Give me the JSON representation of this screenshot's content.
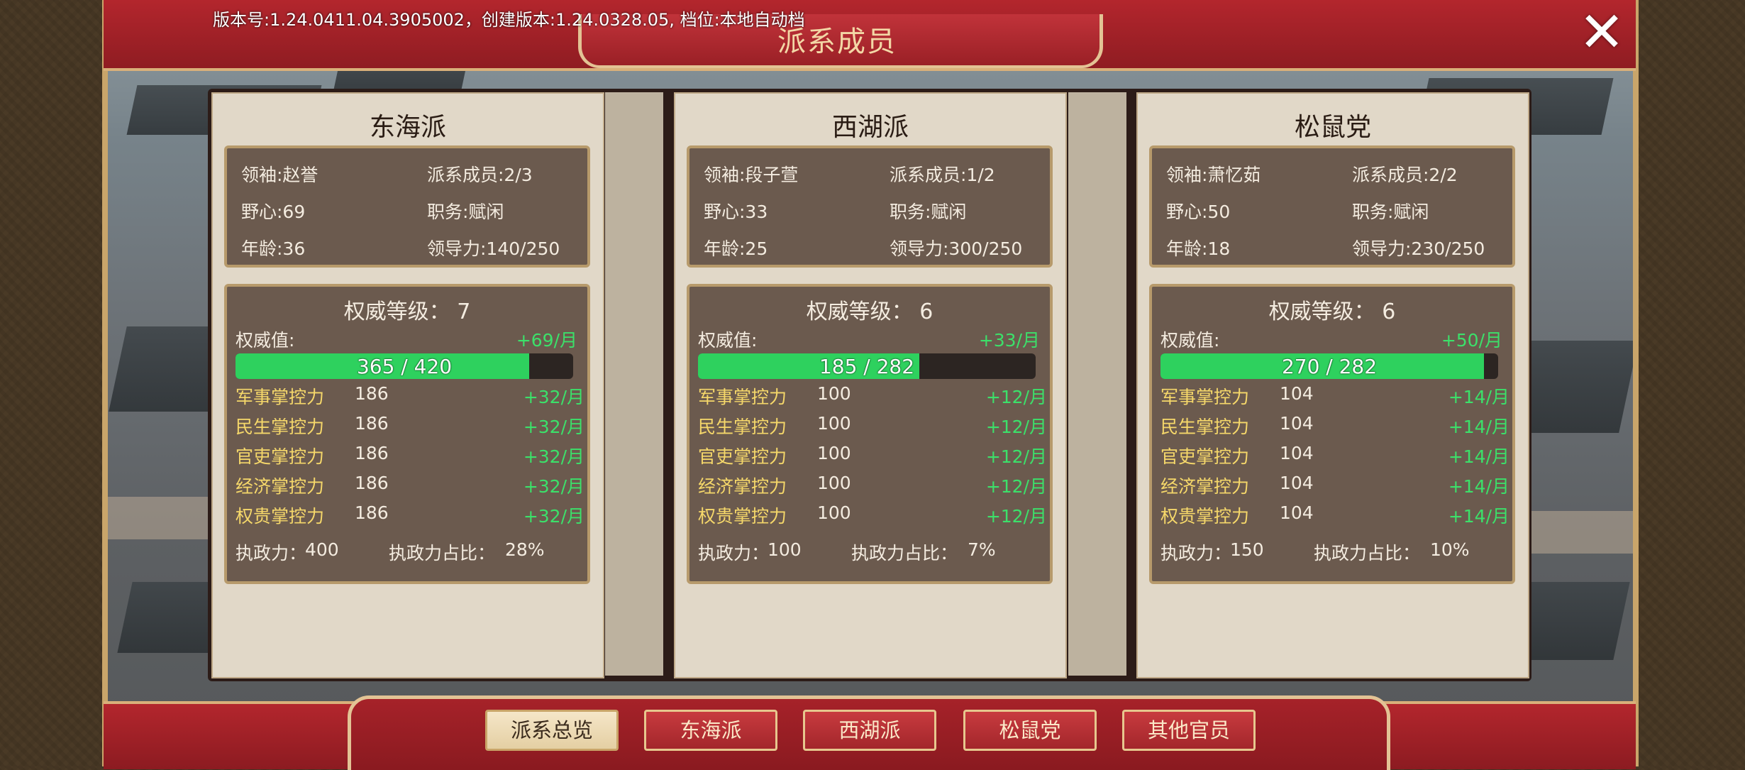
{
  "header": {
    "version_text": "版本号:1.24.0411.04.3905002，创建版本:1.24.0328.05, 档位:本地自动档",
    "title": "派系成员",
    "close_icon": "close-x-icon"
  },
  "colors": {
    "positive": "#3ce06a",
    "control_label": "#f6d86a",
    "bar_fill": "#2ed15e",
    "banner_red": "#b3262d"
  },
  "factions": [
    {
      "name": "东海派",
      "info": {
        "leader": "领袖:赵誉",
        "members": "派系成员:2/3",
        "ambition": "野心:69",
        "position": "职务:赋闲",
        "age": "年龄:36",
        "leadership": "领导力:140/250"
      },
      "authority": {
        "level_text": "权威等级： 7",
        "value_label": "权威值:",
        "rate": "+69/月",
        "current": 365,
        "max": 420,
        "bar_text": "365 / 420"
      },
      "controls": [
        {
          "name": "军事掌控力",
          "value": "186",
          "rate": "+32/月"
        },
        {
          "name": "民生掌控力",
          "value": "186",
          "rate": "+32/月"
        },
        {
          "name": "官吏掌控力",
          "value": "186",
          "rate": "+32/月"
        },
        {
          "name": "经济掌控力",
          "value": "186",
          "rate": "+32/月"
        },
        {
          "name": "权贵掌控力",
          "value": "186",
          "rate": "+32/月"
        }
      ],
      "governance": {
        "label": "执政力：",
        "value": "400",
        "ratio_label": "执政力占比：",
        "ratio": "28%"
      }
    },
    {
      "name": "西湖派",
      "info": {
        "leader": "领袖:段子萱",
        "members": "派系成员:1/2",
        "ambition": "野心:33",
        "position": "职务:赋闲",
        "age": "年龄:25",
        "leadership": "领导力:300/250"
      },
      "authority": {
        "level_text": "权威等级： 6",
        "value_label": "权威值:",
        "rate": "+33/月",
        "current": 185,
        "max": 282,
        "bar_text": "185 / 282"
      },
      "controls": [
        {
          "name": "军事掌控力",
          "value": "100",
          "rate": "+12/月"
        },
        {
          "name": "民生掌控力",
          "value": "100",
          "rate": "+12/月"
        },
        {
          "name": "官吏掌控力",
          "value": "100",
          "rate": "+12/月"
        },
        {
          "name": "经济掌控力",
          "value": "100",
          "rate": "+12/月"
        },
        {
          "name": "权贵掌控力",
          "value": "100",
          "rate": "+12/月"
        }
      ],
      "governance": {
        "label": "执政力：",
        "value": "100",
        "ratio_label": "执政力占比：",
        "ratio": "7%"
      }
    },
    {
      "name": "松鼠党",
      "info": {
        "leader": "领袖:萧忆茹",
        "members": "派系成员:2/2",
        "ambition": "野心:50",
        "position": "职务:赋闲",
        "age": "年龄:18",
        "leadership": "领导力:230/250"
      },
      "authority": {
        "level_text": "权威等级： 6",
        "value_label": "权威值:",
        "rate": "+50/月",
        "current": 270,
        "max": 282,
        "bar_text": "270 / 282"
      },
      "controls": [
        {
          "name": "军事掌控力",
          "value": "104",
          "rate": "+14/月"
        },
        {
          "name": "民生掌控力",
          "value": "104",
          "rate": "+14/月"
        },
        {
          "name": "官吏掌控力",
          "value": "104",
          "rate": "+14/月"
        },
        {
          "name": "经济掌控力",
          "value": "104",
          "rate": "+14/月"
        },
        {
          "name": "权贵掌控力",
          "value": "104",
          "rate": "+14/月"
        }
      ],
      "governance": {
        "label": "执政力：",
        "value": "150",
        "ratio_label": "执政力占比：",
        "ratio": "10%"
      }
    }
  ],
  "nav": {
    "active_index": 0,
    "tabs": [
      "派系总览",
      "东海派",
      "西湖派",
      "松鼠党",
      "其他官员"
    ]
  }
}
